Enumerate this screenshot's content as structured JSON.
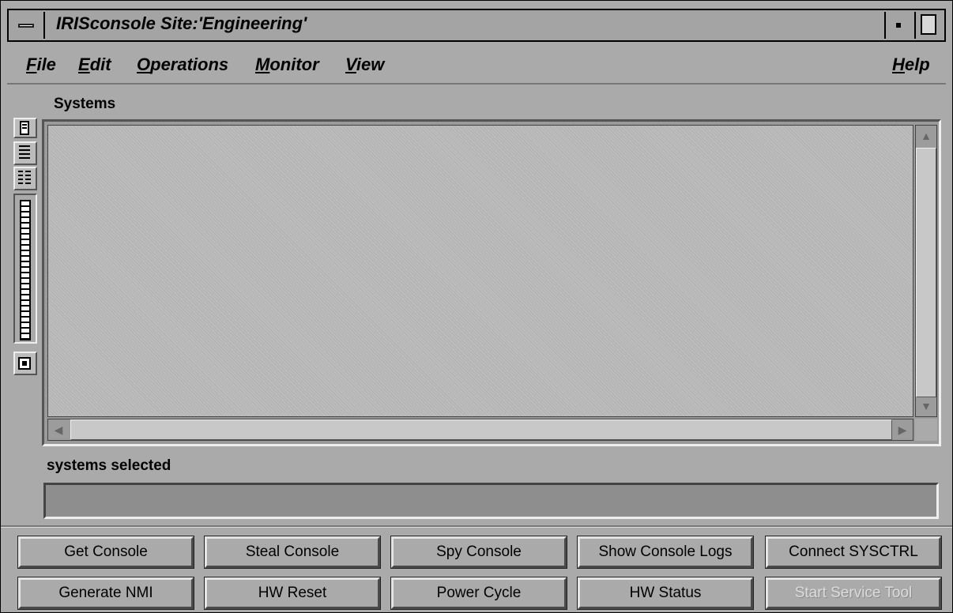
{
  "window": {
    "title": "IRISconsole Site:'Engineering'"
  },
  "menu": {
    "items": [
      {
        "label": "File"
      },
      {
        "label": "Edit"
      },
      {
        "label": "Operations"
      },
      {
        "label": "Monitor"
      },
      {
        "label": "View"
      }
    ],
    "help": "Help"
  },
  "systems": {
    "label": "Systems",
    "items": []
  },
  "selection": {
    "label": "systems selected",
    "value": ""
  },
  "buttons": {
    "row1": [
      {
        "label": "Get Console",
        "enabled": true
      },
      {
        "label": "Steal Console",
        "enabled": true
      },
      {
        "label": "Spy Console",
        "enabled": true
      },
      {
        "label": "Show Console Logs",
        "enabled": true
      },
      {
        "label": "Connect SYSCTRL",
        "enabled": true
      }
    ],
    "row2": [
      {
        "label": "Generate NMI",
        "enabled": true
      },
      {
        "label": "HW Reset",
        "enabled": true
      },
      {
        "label": "Power Cycle",
        "enabled": true
      },
      {
        "label": "HW Status",
        "enabled": true
      },
      {
        "label": "Start Service Tool",
        "enabled": false
      }
    ]
  },
  "icons": {
    "window_menu": "window-menu-icon",
    "minimize": "minimize-icon",
    "maximize": "maximize-icon",
    "view_icons": "computer-icon",
    "view_list": "list-view-icon",
    "view_detail": "detail-view-icon",
    "zoom": "zoom-slider-icon",
    "select_all": "select-all-icon"
  }
}
